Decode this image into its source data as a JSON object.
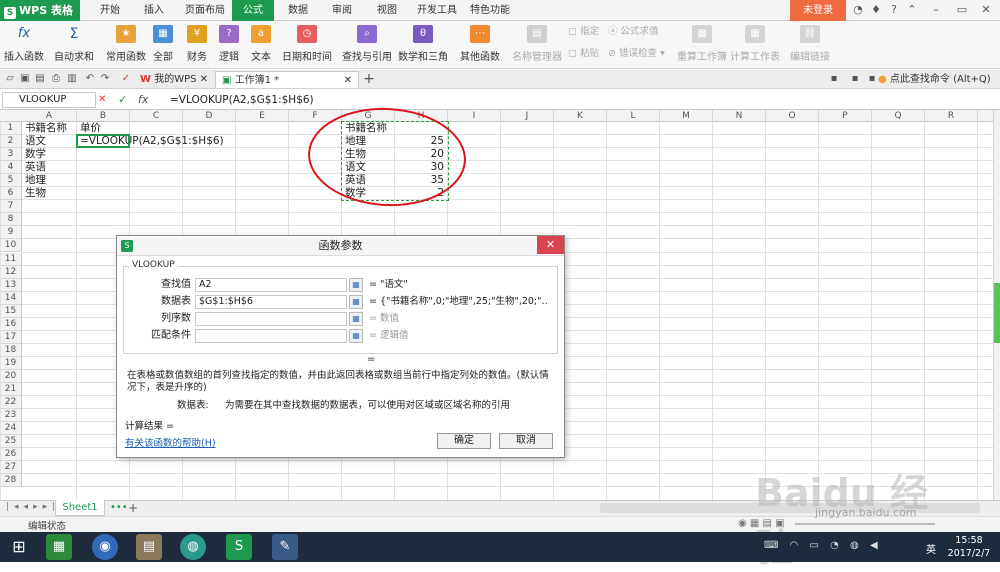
{
  "app": {
    "name": "WPS 表格",
    "login": "未登录"
  },
  "menu_tabs": [
    "开始",
    "插入",
    "页面布局",
    "公式",
    "数据",
    "审阅",
    "视图",
    "开发工具",
    "特色功能"
  ],
  "ribbon": {
    "insert_function": "插入函数",
    "autosum": "自动求和",
    "common": "常用函数",
    "all": "全部",
    "finance": "财务",
    "logic": "逻辑",
    "text": "文本",
    "datetime": "日期和时间",
    "lookup": "查找与引用",
    "math": "数学和三角",
    "other": "其他函数",
    "name_manager": "名称管理器",
    "specify": "指定",
    "paste": "粘贴",
    "formula_eval": "公式求值",
    "error_check": "错误检查",
    "recalc_book": "重算工作簿",
    "calc_sheet": "计算工作表",
    "edit_links": "编辑链接"
  },
  "doc_tabs": {
    "my_wps": "我的WPS",
    "workbook": "工作簿1 *",
    "help_search": "点此查找命令 (Alt+Q)"
  },
  "formula_bar": {
    "name_box": "VLOOKUP",
    "cancel": "✕",
    "confirm": "✓",
    "fx": "fx",
    "formula": "=VLOOKUP(A2,$G$1:$H$6)"
  },
  "columns": [
    "A",
    "B",
    "C",
    "D",
    "E",
    "F",
    "G",
    "H",
    "I",
    "J",
    "K",
    "L",
    "M",
    "N",
    "O",
    "P",
    "Q",
    "R"
  ],
  "rows": [
    "1",
    "2",
    "3",
    "4",
    "5",
    "6",
    "7",
    "8",
    "9",
    "10",
    "11",
    "12",
    "13",
    "14",
    "15",
    "16",
    "17",
    "18",
    "19",
    "20",
    "21",
    "22",
    "23",
    "24",
    "25",
    "26",
    "27",
    "28"
  ],
  "cells": {
    "A1": "书籍名称",
    "B1": "单价",
    "A2": "语文",
    "B2": "=VLOOKUP(A2,$G$1:$H$6)",
    "A3": "数学",
    "A4": "英语",
    "A5": "地理",
    "A6": "生物",
    "G1": "书籍名称",
    "G2": "地理",
    "H2": "25",
    "G3": "生物",
    "H3": "20",
    "G4": "语文",
    "H4": "30",
    "G5": "英语",
    "H5": "35",
    "G6": "数学",
    "H6": "2"
  },
  "sheet": {
    "tab": "Sheet1",
    "status": "编辑状态"
  },
  "dialog": {
    "title": "函数参数",
    "group": "VLOOKUP",
    "params": [
      {
        "label": "查找值",
        "value": "A2",
        "result": "= \"语文\""
      },
      {
        "label": "数据表",
        "value": "$G$1:$H$6",
        "result": "= {\"书籍名称\",0;\"地理\",25;\"生物\",20;\"…"
      },
      {
        "label": "列序数",
        "value": "",
        "result": "= 数值"
      },
      {
        "label": "匹配条件",
        "value": "",
        "result": "= 逻辑值"
      }
    ],
    "equals": "=",
    "desc": "在表格或数值数组的首列查找指定的数值，并由此返回表格或数组当前行中指定列处的数值。(默认情况下，表是升序的)",
    "param_desc_label": "数据表:",
    "param_desc": "为需要在其中查找数据的数据表，可以使用对区域或区域名称的引用",
    "calc_result": "计算结果 =",
    "help_link": "有关该函数的帮助(H)",
    "ok": "确定",
    "cancel": "取消"
  },
  "taskbar": {
    "time": "15:58",
    "date": "2017/2/7",
    "ime": "英"
  },
  "watermark": "Baidu 经验",
  "watermark_url": "jingyan.baidu.com",
  "colors": {
    "accent": "#1e9a4e",
    "login": "#ef6a3c",
    "annotation": "#d8141c"
  }
}
